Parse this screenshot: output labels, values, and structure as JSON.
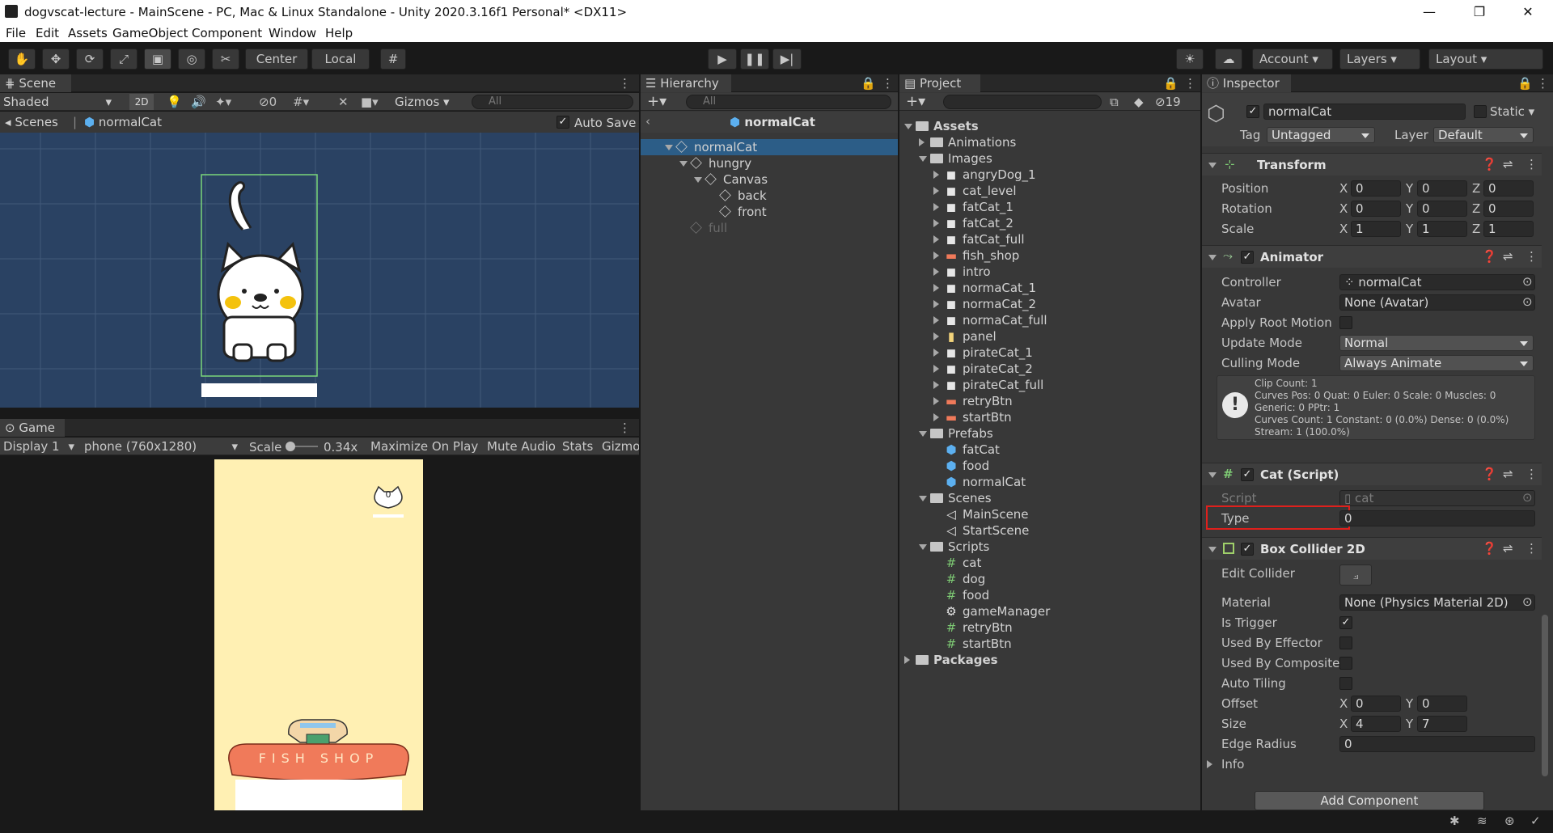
{
  "window": {
    "title": "dogvscat-lecture - MainScene - PC, Mac & Linux Standalone - Unity 2020.3.16f1 Personal* <DX11>",
    "minimize": "—",
    "maximize": "❐",
    "close": "✕"
  },
  "menu": [
    "File",
    "Edit",
    "Assets",
    "GameObject",
    "Component",
    "Window",
    "Help"
  ],
  "toolbar": {
    "pivot": "Center",
    "space": "Local",
    "account": "Account",
    "layers": "Layers",
    "layout": "Layout"
  },
  "scene": {
    "tab": "Scene",
    "shading": "Shaded",
    "mode2d": "2D",
    "hidden_count": "0",
    "gizmos": "Gizmos",
    "search_placeholder": "All",
    "breadcrumb_root": "Scenes",
    "breadcrumb_item": "normalCat",
    "auto_save": "Auto Save"
  },
  "game": {
    "tab": "Game",
    "display": "Display 1",
    "resolution": "phone (760x1280)",
    "scale_label": "Scale",
    "scale_value": "0.34x",
    "maximize": "Maximize On Play",
    "mute": "Mute Audio",
    "stats": "Stats",
    "gizmos": "Gizmo",
    "score": "0",
    "shop_text": "FISH SHOP"
  },
  "hierarchy": {
    "tab": "Hierarchy",
    "search_placeholder": "All",
    "prefab_title": "normalCat",
    "rows": [
      {
        "label": "normalCat",
        "depth": 0,
        "selected": true,
        "dim": false
      },
      {
        "label": "hungry",
        "depth": 1,
        "selected": false,
        "dim": false
      },
      {
        "label": "Canvas",
        "depth": 2,
        "selected": false,
        "dim": false
      },
      {
        "label": "back",
        "depth": 3,
        "selected": false,
        "dim": false
      },
      {
        "label": "front",
        "depth": 3,
        "selected": false,
        "dim": false
      },
      {
        "label": "full",
        "depth": 1,
        "selected": false,
        "dim": true
      }
    ]
  },
  "project": {
    "tab": "Project",
    "hidden_count": "19",
    "rows": [
      {
        "label": "Assets",
        "depth": 0,
        "icon": "folder",
        "open": true,
        "bold": true
      },
      {
        "label": "Animations",
        "depth": 1,
        "icon": "folder",
        "open": false
      },
      {
        "label": "Images",
        "depth": 1,
        "icon": "folder",
        "open": true
      },
      {
        "label": "angryDog_1",
        "depth": 2,
        "icon": "sprite",
        "open": false
      },
      {
        "label": "cat_level",
        "depth": 2,
        "icon": "sprite",
        "open": false
      },
      {
        "label": "fatCat_1",
        "depth": 2,
        "icon": "sprite",
        "open": false
      },
      {
        "label": "fatCat_2",
        "depth": 2,
        "icon": "sprite",
        "open": false
      },
      {
        "label": "fatCat_full",
        "depth": 2,
        "icon": "sprite",
        "open": false
      },
      {
        "label": "fish_shop",
        "depth": 2,
        "icon": "sprite-orange",
        "open": false
      },
      {
        "label": "intro",
        "depth": 2,
        "icon": "sprite",
        "open": false
      },
      {
        "label": "normaCat_1",
        "depth": 2,
        "icon": "sprite",
        "open": false
      },
      {
        "label": "normaCat_2",
        "depth": 2,
        "icon": "sprite",
        "open": false
      },
      {
        "label": "normaCat_full",
        "depth": 2,
        "icon": "sprite",
        "open": false
      },
      {
        "label": "panel",
        "depth": 2,
        "icon": "sprite-yellow",
        "open": false
      },
      {
        "label": "pirateCat_1",
        "depth": 2,
        "icon": "sprite",
        "open": false
      },
      {
        "label": "pirateCat_2",
        "depth": 2,
        "icon": "sprite",
        "open": false
      },
      {
        "label": "pirateCat_full",
        "depth": 2,
        "icon": "sprite",
        "open": false
      },
      {
        "label": "retryBtn",
        "depth": 2,
        "icon": "sprite-orange",
        "open": false
      },
      {
        "label": "startBtn",
        "depth": 2,
        "icon": "sprite-orange",
        "open": false
      },
      {
        "label": "Prefabs",
        "depth": 1,
        "icon": "folder",
        "open": true
      },
      {
        "label": "fatCat",
        "depth": 2,
        "icon": "prefab",
        "leaf": true
      },
      {
        "label": "food",
        "depth": 2,
        "icon": "prefab",
        "leaf": true
      },
      {
        "label": "normalCat",
        "depth": 2,
        "icon": "prefab",
        "leaf": true
      },
      {
        "label": "Scenes",
        "depth": 1,
        "icon": "folder",
        "open": true
      },
      {
        "label": "MainScene",
        "depth": 2,
        "icon": "scene",
        "leaf": true
      },
      {
        "label": "StartScene",
        "depth": 2,
        "icon": "scene",
        "leaf": true
      },
      {
        "label": "Scripts",
        "depth": 1,
        "icon": "folder",
        "open": true
      },
      {
        "label": "cat",
        "depth": 2,
        "icon": "script",
        "leaf": true
      },
      {
        "label": "dog",
        "depth": 2,
        "icon": "script",
        "leaf": true
      },
      {
        "label": "food",
        "depth": 2,
        "icon": "script",
        "leaf": true
      },
      {
        "label": "gameManager",
        "depth": 2,
        "icon": "gear",
        "leaf": true
      },
      {
        "label": "retryBtn",
        "depth": 2,
        "icon": "script",
        "leaf": true
      },
      {
        "label": "startBtn",
        "depth": 2,
        "icon": "script",
        "leaf": true
      },
      {
        "label": "Packages",
        "depth": 0,
        "icon": "folder",
        "open": false,
        "bold": true
      }
    ]
  },
  "inspector": {
    "tab": "Inspector",
    "object_name": "normalCat",
    "static": "Static",
    "tag_label": "Tag",
    "tag_value": "Untagged",
    "layer_label": "Layer",
    "layer_value": "Default",
    "transform": {
      "title": "Transform",
      "position_label": "Position",
      "position": [
        "0",
        "0",
        "0"
      ],
      "rotation_label": "Rotation",
      "rotation": [
        "0",
        "0",
        "0"
      ],
      "scale_label": "Scale",
      "scale": [
        "1",
        "1",
        "1"
      ]
    },
    "animator": {
      "title": "Animator",
      "controller_label": "Controller",
      "controller": "normalCat",
      "avatar_label": "Avatar",
      "avatar": "None (Avatar)",
      "root_motion_label": "Apply Root Motion",
      "update_mode_label": "Update Mode",
      "update_mode": "Normal",
      "culling_label": "Culling Mode",
      "culling": "Always Animate",
      "info": [
        "Clip Count: 1",
        "Curves Pos: 0 Quat: 0 Euler: 0 Scale: 0 Muscles: 0",
        "Generic: 0 PPtr: 1",
        "Curves Count: 1 Constant: 0 (0.0%) Dense: 0 (0.0%)",
        "Stream: 1 (100.0%)"
      ]
    },
    "cat_script": {
      "title": "Cat (Script)",
      "script_label": "Script",
      "script": "cat",
      "type_label": "Type",
      "type": "0"
    },
    "box_collider": {
      "title": "Box Collider 2D",
      "edit_label": "Edit Collider",
      "material_label": "Material",
      "material": "None (Physics Material 2D)",
      "trigger_label": "Is Trigger",
      "effector_label": "Used By Effector",
      "composite_label": "Used By Composite",
      "tiling_label": "Auto Tiling",
      "offset_label": "Offset",
      "offset": [
        "0",
        "0"
      ],
      "size_label": "Size",
      "size": [
        "4",
        "7"
      ],
      "edge_label": "Edge Radius",
      "edge": "0",
      "info_label": "Info"
    },
    "add_component": "Add Component"
  },
  "colors": {
    "accent": "#2c5d87",
    "highlight_box": "#e0201c",
    "scene_bg": "#2a4263",
    "game_bg": "#fff0b3",
    "shop_red": "#f07a5a"
  }
}
